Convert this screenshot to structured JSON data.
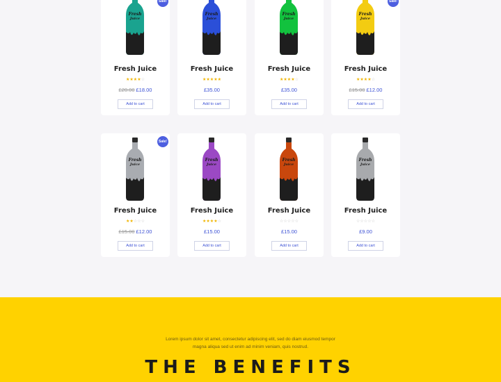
{
  "products": [
    {
      "title": "Fresh Juice",
      "color": "#1aa38f",
      "sale": true,
      "rating": 4,
      "old_price": "£20.00",
      "price": "£18.00",
      "button": "Add to cart",
      "badge": "Sale!",
      "label_top": "Fresh",
      "label_bottom": "Juice"
    },
    {
      "title": "Fresh Juice",
      "color": "#2b4fd8",
      "sale": false,
      "rating": 5,
      "old_price": "",
      "price": "£35.00",
      "button": "Add to cart",
      "badge": "",
      "label_top": "Fresh",
      "label_bottom": "Juice"
    },
    {
      "title": "Fresh Juice",
      "color": "#12c23e",
      "sale": false,
      "rating": 4,
      "old_price": "",
      "price": "£35.00",
      "button": "Add to cart",
      "badge": "",
      "label_top": "Fresh",
      "label_bottom": "Juice"
    },
    {
      "title": "Fresh Juice",
      "color": "#f3cc12",
      "sale": true,
      "rating": 4,
      "old_price": "£15.00",
      "price": "£12.00",
      "button": "Add to cart",
      "badge": "Sale!",
      "label_top": "Fresh",
      "label_bottom": "Juice"
    },
    {
      "title": "Fresh Juice",
      "color": "#a9acb1",
      "sale": true,
      "rating": 2,
      "old_price": "£15.00",
      "price": "£12.00",
      "button": "Add to cart",
      "badge": "Sale!",
      "label_top": "Fresh",
      "label_bottom": "Juice"
    },
    {
      "title": "Fresh Juice",
      "color": "#9b49c4",
      "sale": false,
      "rating": 4,
      "old_price": "",
      "price": "£15.00",
      "button": "Add to cart",
      "badge": "",
      "label_top": "Fresh",
      "label_bottom": "Juice"
    },
    {
      "title": "Fresh Juice",
      "color": "#c9470d",
      "sale": false,
      "rating": 0,
      "old_price": "",
      "price": "£15.00",
      "button": "Add to cart",
      "badge": "",
      "label_top": "Fresh",
      "label_bottom": "Juice"
    },
    {
      "title": "Fresh Juice",
      "color": "#a8aaad",
      "sale": false,
      "rating": 0,
      "old_price": "",
      "price": "£9.00",
      "button": "Add to cart",
      "badge": "",
      "label_top": "Fresh",
      "label_bottom": "Juice"
    }
  ],
  "benefits": {
    "text": "Lorem ipsum dolor sit amet, consectetur adipiscing elit, sed do diam eiusmod tempor magna aliqua sed ut enim ad minim veniam, quis nostrud.",
    "heading": "THE BENEFITS",
    "background": "#ffd200"
  },
  "colors": {
    "accent": "#3d52d5",
    "star": "#f0b400",
    "badge": "#4d5fe0"
  }
}
